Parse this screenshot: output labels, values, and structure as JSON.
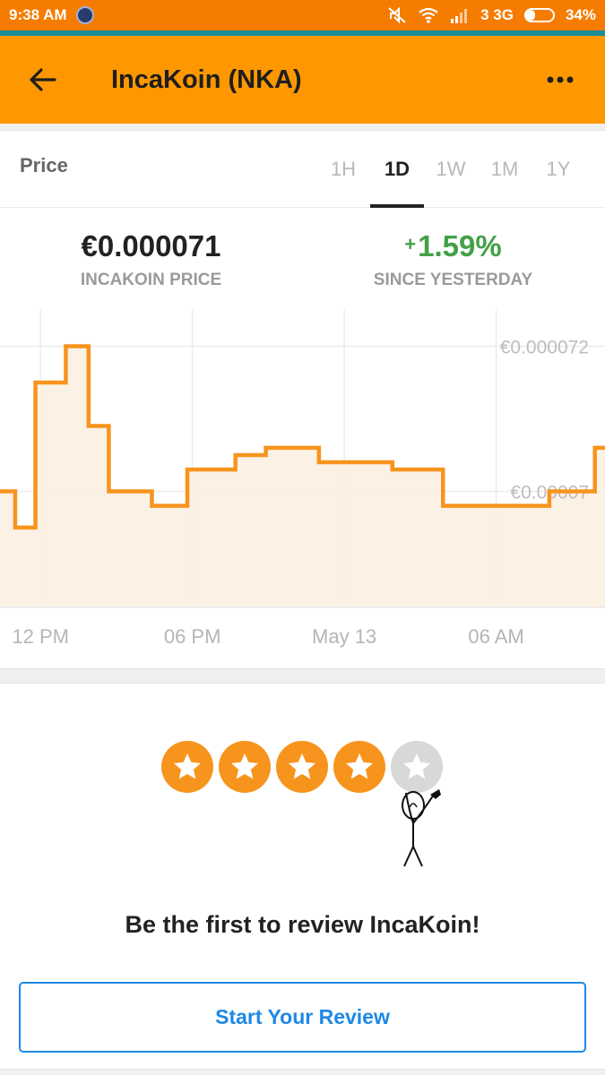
{
  "status_bar": {
    "time": "9:38 AM",
    "network": "3 3G",
    "battery": "34%",
    "battery_level": 0.34,
    "icons": [
      "app-notification-icon",
      "mute-icon",
      "wifi-icon",
      "signal-icon",
      "battery-icon"
    ]
  },
  "app_bar": {
    "title": "IncaKoin (NKA)",
    "back_icon": "arrow-left-icon",
    "menu_icon": "more-horizontal-icon"
  },
  "price_card": {
    "label": "Price",
    "tabs": [
      {
        "label": "1H",
        "active": false
      },
      {
        "label": "1D",
        "active": true
      },
      {
        "label": "1W",
        "active": false
      },
      {
        "label": "1M",
        "active": false
      },
      {
        "label": "1Y",
        "active": false
      }
    ],
    "price_value": "€0.000071",
    "price_caption": "INCAKOIN PRICE",
    "change_sign": "+",
    "change_value": "1.59%",
    "change_caption": "SINCE YESTERDAY"
  },
  "chart_data": {
    "type": "line",
    "step": true,
    "x_tick_labels": [
      "12 PM",
      "06 PM",
      "May 13",
      "06 AM"
    ],
    "y_tick_labels": [
      "€0.000072",
      "€0.00007"
    ],
    "y_ticks": [
      7.2e-05,
      7e-05
    ],
    "ylim": [
      6.84e-05,
      7.25e-05
    ],
    "xlim": [
      -1.6,
      22.3
    ],
    "x": [
      -1.6,
      -1.0,
      -0.2,
      1.0,
      1.9,
      2.7,
      4.4,
      5.8,
      7.7,
      8.9,
      11.0,
      13.9,
      15.9,
      18.0,
      20.1,
      21.9
    ],
    "values": [
      7e-05,
      6.95e-05,
      7.15e-05,
      7.2e-05,
      7.09e-05,
      7e-05,
      6.98e-05,
      7.03e-05,
      7.05e-05,
      7.06e-05,
      7.04e-05,
      7.03e-05,
      6.98e-05,
      6.98e-05,
      7e-05,
      7.06e-05
    ],
    "line_color": "#f7941d",
    "fill_color": "#fbefe0",
    "grid": true
  },
  "review_card": {
    "rating": 4,
    "max_rating": 5,
    "text": "Be the first to review IncaKoin!",
    "button_label": "Start Your Review",
    "star_color": "#f7941d",
    "empty_star_color": "#d8d8d8",
    "button_color": "#1e88e5"
  }
}
